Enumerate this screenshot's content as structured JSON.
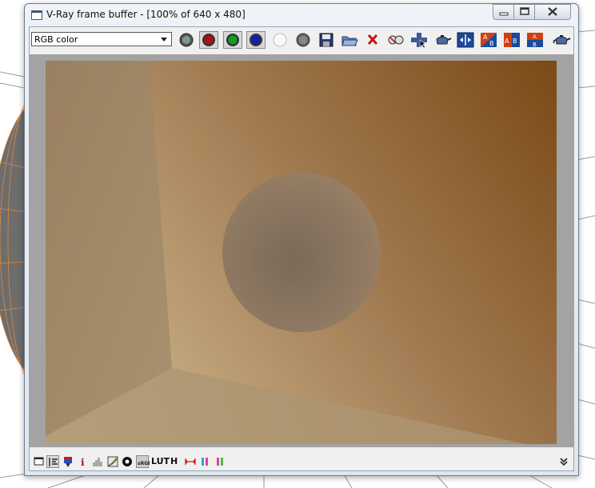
{
  "window": {
    "title": "V-Ray frame buffer - [100% of 640 x 480]"
  },
  "toolbar": {
    "channel_value": "RGB color",
    "icons": [
      "rgb-channels-icon",
      "red-channel-icon",
      "green-channel-icon",
      "blue-channel-icon",
      "alpha-channel-icon",
      "monochrome-icon",
      "save-image-icon",
      "load-image-icon",
      "clear-image-icon",
      "track-mouse-icon",
      "region-render-icon",
      "render-last-icon",
      "compare-ab-horizontal-icon",
      "ab-compare-icon",
      "ab-swap-icon",
      "ab-vertical-icon",
      "render-teapot-icon"
    ]
  },
  "bottom_bar": {
    "lut_label": "LUT",
    "h_label": "H"
  },
  "colors": {
    "render_bg": "#a3a3a3",
    "wall_light": "#b59f7e",
    "wall_dark": "#7a4a14",
    "sphere": "#8a7560"
  }
}
